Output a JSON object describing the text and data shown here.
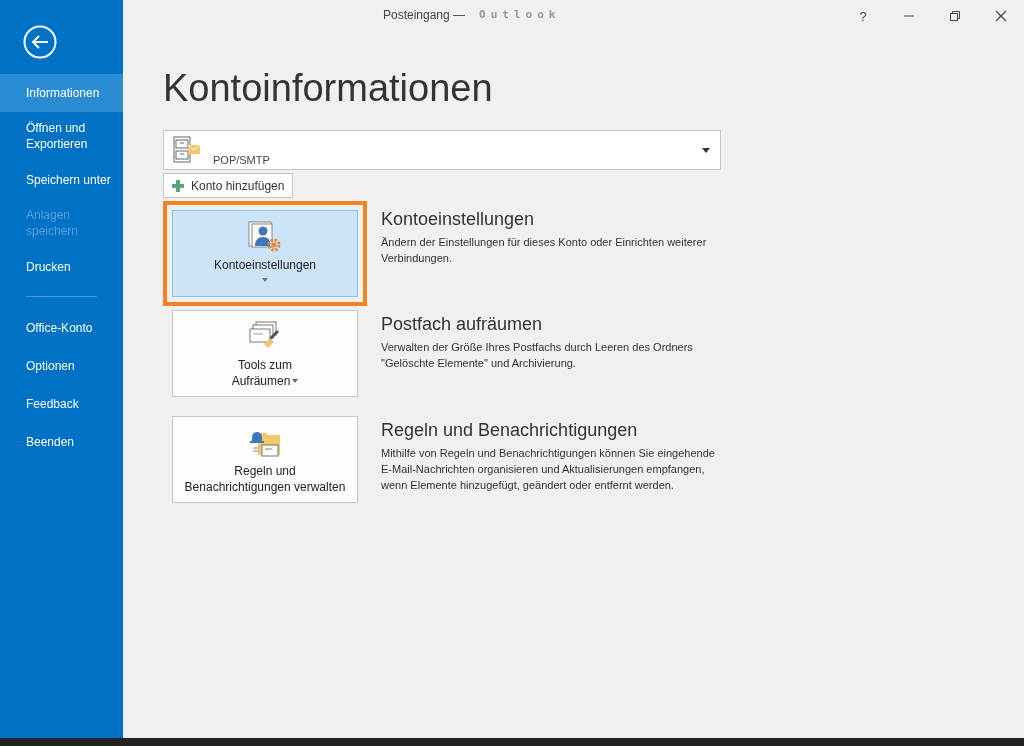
{
  "window": {
    "title": "Posteingang —",
    "app_name": "Outlook",
    "controls": [
      "?"
    ]
  },
  "sidebar": {
    "items": [
      {
        "label": "Informationen",
        "selected": true,
        "disabled": false,
        "divider_after": false
      },
      {
        "label": "Öffnen und Exportieren",
        "selected": false,
        "disabled": false,
        "divider_after": false
      },
      {
        "label": "Speichern unter",
        "selected": false,
        "disabled": false,
        "divider_after": false
      },
      {
        "label": "Anlagen speichern",
        "selected": false,
        "disabled": true,
        "divider_after": false
      },
      {
        "label": "Drucken",
        "selected": false,
        "disabled": false,
        "divider_after": true
      },
      {
        "label": "Office-Konto",
        "selected": false,
        "disabled": false,
        "divider_after": false
      },
      {
        "label": "Optionen",
        "selected": false,
        "disabled": false,
        "divider_after": false
      },
      {
        "label": "Feedback",
        "selected": false,
        "disabled": false,
        "divider_after": false
      },
      {
        "label": "Beenden",
        "selected": false,
        "disabled": false,
        "divider_after": false
      }
    ]
  },
  "page_title": "Kontoinformationen",
  "account_selector": {
    "value": "POP/SMTP"
  },
  "add_account_button": "Konto hinzufügen",
  "actions": [
    {
      "kind": "settings",
      "button_lines": [
        "Kontoeinstellungen"
      ],
      "caret_below": true,
      "caret_inline": false,
      "selected": true,
      "highlighted": true,
      "heading": "Kontoeinstellungen",
      "description": "Ändern der Einstellungen für dieses Konto oder Einrichten weiterer Verbindungen."
    },
    {
      "kind": "cleanup",
      "button_lines": [
        "Tools zum",
        "Aufräumen"
      ],
      "caret_below": false,
      "caret_inline": true,
      "selected": false,
      "highlighted": false,
      "heading": "Postfach aufräumen",
      "description": "Verwalten der Größe Ihres Postfachs durch Leeren des Ordners \"Gelöschte Elemente\" und Archivierung."
    },
    {
      "kind": "rules",
      "button_lines": [
        "Regeln und",
        "Benachrichtigungen verwalten"
      ],
      "caret_below": false,
      "caret_inline": false,
      "selected": false,
      "highlighted": false,
      "heading": "Regeln und Benachrichtigungen",
      "description": "Mithilfe von Regeln und Benachrichtigungen können Sie eingehende E-Mail-Nachrichten organisieren und Aktualisierungen empfangen, wenn Elemente hinzugefügt, geändert oder entfernt werden."
    }
  ]
}
